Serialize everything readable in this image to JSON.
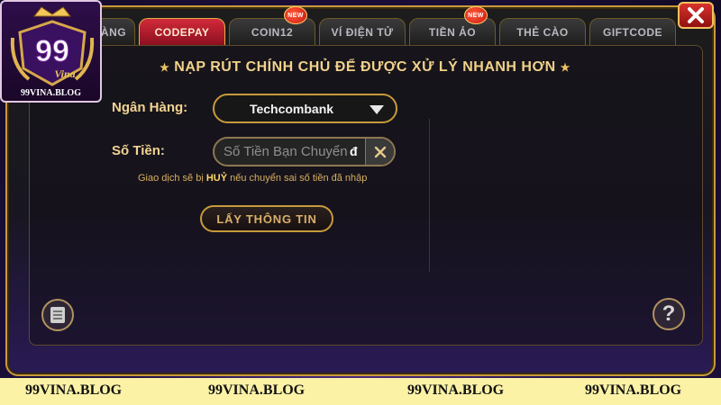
{
  "brand": {
    "logo_number": "99",
    "logo_script": "Vina",
    "logo_text": "99VINA.BLOG"
  },
  "tabs": [
    {
      "label": "ÀNG",
      "active": false,
      "new_badge": false
    },
    {
      "label": "CODEPAY",
      "active": true,
      "new_badge": false
    },
    {
      "label": "COIN12",
      "active": false,
      "new_badge": true
    },
    {
      "label": "VÍ ĐIỆN TỬ",
      "active": false,
      "new_badge": false
    },
    {
      "label": "TIỀN ẢO",
      "active": false,
      "new_badge": true
    },
    {
      "label": "THẺ CÀO",
      "active": false,
      "new_badge": false
    },
    {
      "label": "GIFTCODE",
      "active": false,
      "new_badge": false
    }
  ],
  "badge_label": "NEW",
  "notice": "NẠP RÚT CHÍNH CHỦ ĐỂ ĐƯỢC XỬ LÝ NHANH HƠN",
  "form": {
    "bank_label": "Ngân Hàng:",
    "bank_value": "Techcombank",
    "amount_label": "Số Tiền:",
    "amount_placeholder": "Số Tiền Bạn Chuyển",
    "amount_value": "",
    "currency_symbol": "đ",
    "hint_before": "Giao dịch sẽ bị ",
    "hint_emphasis": "HUỶ",
    "hint_after": " nếu chuyển sai số tiền đã nhập",
    "submit_label": "LẤY THÔNG TIN"
  },
  "help_glyph": "?",
  "watermark": [
    "99VINA.BLOG",
    "99VINA.BLOG",
    "99VINA.BLOG",
    "99VINA.BLOG"
  ],
  "colors": {
    "accent_gold": "#c79a3b",
    "active_tab_red": "#d22a3a",
    "label_gold": "#f2d391",
    "strip_bg": "#fbf2a6"
  }
}
